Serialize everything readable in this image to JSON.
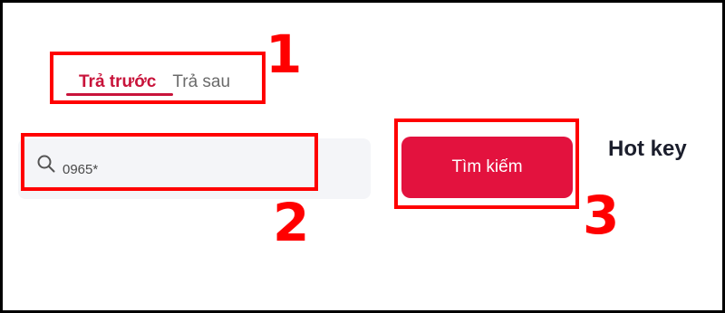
{
  "tabs": [
    {
      "label": "Trả trước",
      "active": true
    },
    {
      "label": "Trả sau",
      "active": false
    }
  ],
  "search": {
    "value": "0965*",
    "icon": "search-icon"
  },
  "button": {
    "label": "Tìm kiếm"
  },
  "hotkey": {
    "label": "Hot key"
  },
  "annotations": [
    {
      "number": "1"
    },
    {
      "number": "2"
    },
    {
      "number": "3"
    }
  ],
  "colors": {
    "accent": "#e3123e",
    "active_tab": "#c8133a",
    "annotation": "#ff0000",
    "input_bg": "#f4f5f8"
  }
}
